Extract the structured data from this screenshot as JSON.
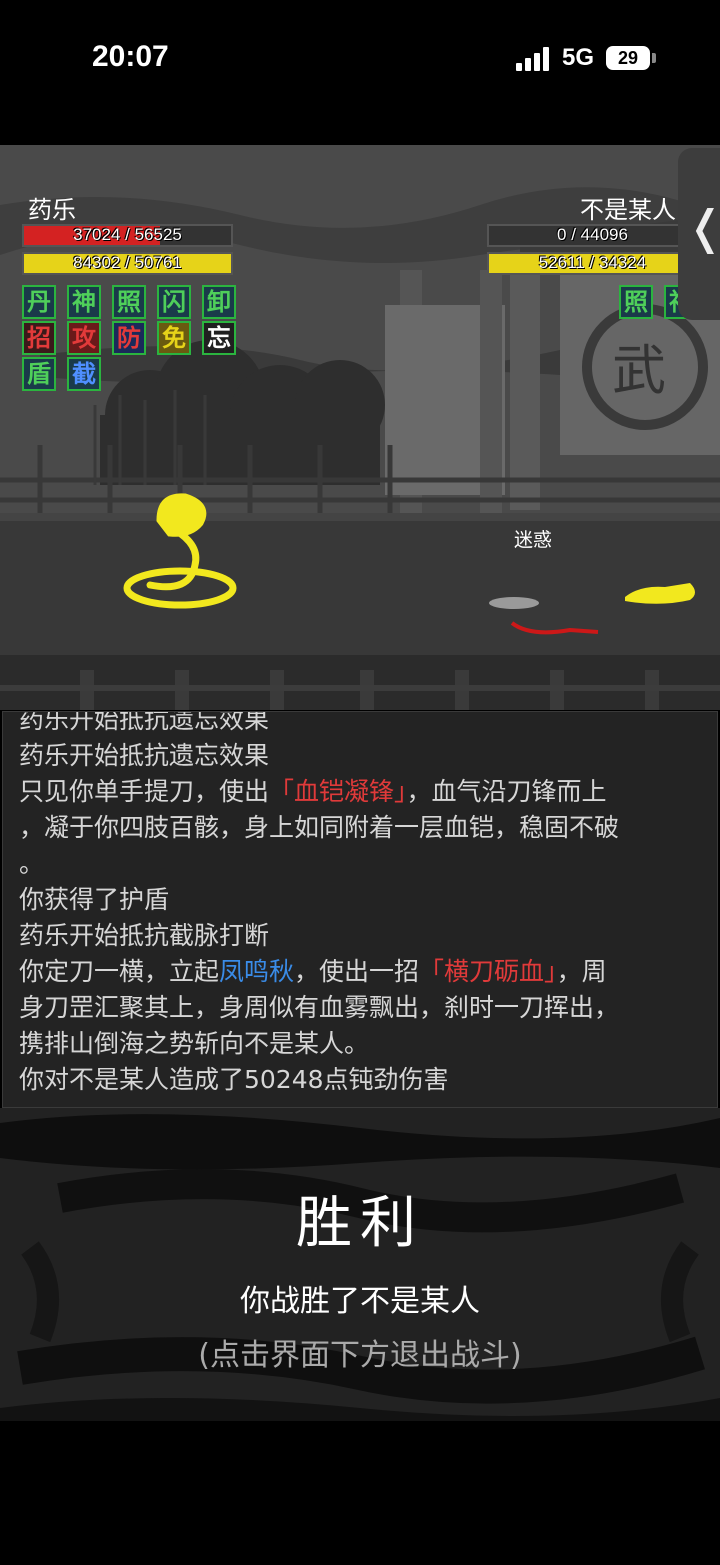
{
  "status_bar": {
    "time": "20:07",
    "network": "5G",
    "battery": "29"
  },
  "player": {
    "name": "药乐",
    "hp": "37024 / 56525",
    "hp_ratio": 0.655,
    "hp_color": "#d42222",
    "mp": "84302 / 50761",
    "mp_ratio": 1.0,
    "mp_color": "#e6d319",
    "buffs": [
      {
        "char": "丹",
        "color": "#4fcf5a",
        "bg": "#1a3a4a"
      },
      {
        "char": "神",
        "color": "#4fcf5a",
        "bg": "#1a3a4a"
      },
      {
        "char": "照",
        "color": "#4fcf5a",
        "bg": "#1a3a4a"
      },
      {
        "char": "闪",
        "color": "#4fcf5a",
        "bg": "#1a3a4a"
      },
      {
        "char": "卸",
        "color": "#4fcf5a",
        "bg": "#1a3a4a"
      },
      {
        "char": "招",
        "color": "#e23a3a",
        "bg": "#3a1a1a"
      },
      {
        "char": "攻",
        "color": "#e23a3a",
        "bg": "#6a1a1a"
      },
      {
        "char": "防",
        "color": "#e23a3a",
        "bg": "#1a2a5a"
      },
      {
        "char": "免",
        "color": "#e6d319",
        "bg": "#6a5a10"
      },
      {
        "char": "忘",
        "color": "#ffffff",
        "bg": "#202020"
      },
      {
        "char": "盾",
        "color": "#4fcf5a",
        "bg": "#1a3a4a"
      },
      {
        "char": "截",
        "color": "#4f8fff",
        "bg": "#1a3a4a"
      }
    ]
  },
  "enemy": {
    "name": "不是某人",
    "hp": "0 / 44096",
    "hp_ratio": 0.0,
    "hp_color": "#d42222",
    "mp": "52611 / 34324",
    "mp_ratio": 1.0,
    "mp_color": "#e6d319",
    "buffs": [
      {
        "char": "照",
        "color": "#4fcf5a",
        "bg": "#1a3a4a"
      },
      {
        "char": "神",
        "color": "#4fcf5a",
        "bg": "#1a3a4a"
      }
    ]
  },
  "scene": {
    "status_label": "迷惑",
    "side_tab_glyph": "❬"
  },
  "log": [
    [
      {
        "t": "药乐开始抵抗遗忘效果"
      }
    ],
    [
      {
        "t": "药乐开始抵抗遗忘效果"
      }
    ],
    [
      {
        "t": "只见你单手提刀，使出"
      },
      {
        "t": "「血铠凝锋」",
        "c": "red"
      },
      {
        "t": "，血气沿刀锋而上"
      }
    ],
    [
      {
        "t": "，凝于你四肢百骸，身上如同附着一层血铠，稳固不破"
      }
    ],
    [
      {
        "t": "。"
      }
    ],
    [
      {
        "t": "你获得了护盾"
      }
    ],
    [
      {
        "t": "药乐开始抵抗截脉打断"
      }
    ],
    [
      {
        "t": "你定刀一横，立起"
      },
      {
        "t": "凤鸣秋",
        "c": "blue"
      },
      {
        "t": "，使出一招"
      },
      {
        "t": "「横刀砺血」",
        "c": "red"
      },
      {
        "t": "，周"
      }
    ],
    [
      {
        "t": "身刀罡汇聚其上，身周似有血雾飘出，刹时一刀挥出，"
      }
    ],
    [
      {
        "t": "携排山倒海之势斩向不是某人。"
      }
    ],
    [
      {
        "t": "你对不是某人造成了50248点钝劲伤害"
      }
    ]
  ],
  "result": {
    "title": "胜利",
    "subtitle": "你战胜了不是某人",
    "hint": "(点击界面下方退出战斗)"
  }
}
